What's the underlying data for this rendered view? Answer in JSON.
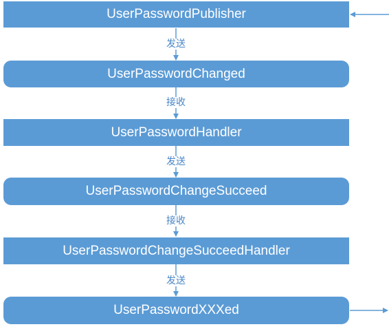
{
  "diagram": {
    "nodes": [
      {
        "label": "UserPasswordPublisher",
        "shape": "rect"
      },
      {
        "label": "UserPasswordChanged",
        "shape": "rounded"
      },
      {
        "label": "UserPasswordHandler",
        "shape": "rect"
      },
      {
        "label": "UserPasswordChangeSucceed",
        "shape": "rounded"
      },
      {
        "label": "UserPasswordChangeSucceedHandler",
        "shape": "rect"
      },
      {
        "label": "UserPasswordXXXed",
        "shape": "rounded"
      }
    ],
    "edges": [
      {
        "from": 0,
        "to": 1,
        "label": "发送"
      },
      {
        "from": 1,
        "to": 2,
        "label": "接收"
      },
      {
        "from": 2,
        "to": 3,
        "label": "发送"
      },
      {
        "from": 3,
        "to": 4,
        "label": "接收"
      },
      {
        "from": 4,
        "to": 5,
        "label": "发送"
      }
    ],
    "incoming_arrow_target": 0,
    "outgoing_arrow_source": 5
  },
  "colors": {
    "node_fill": "#5b9bd5",
    "node_text": "#ffffff",
    "connector": "#5b9bd5",
    "edge_label_text": "#4a86c5"
  }
}
